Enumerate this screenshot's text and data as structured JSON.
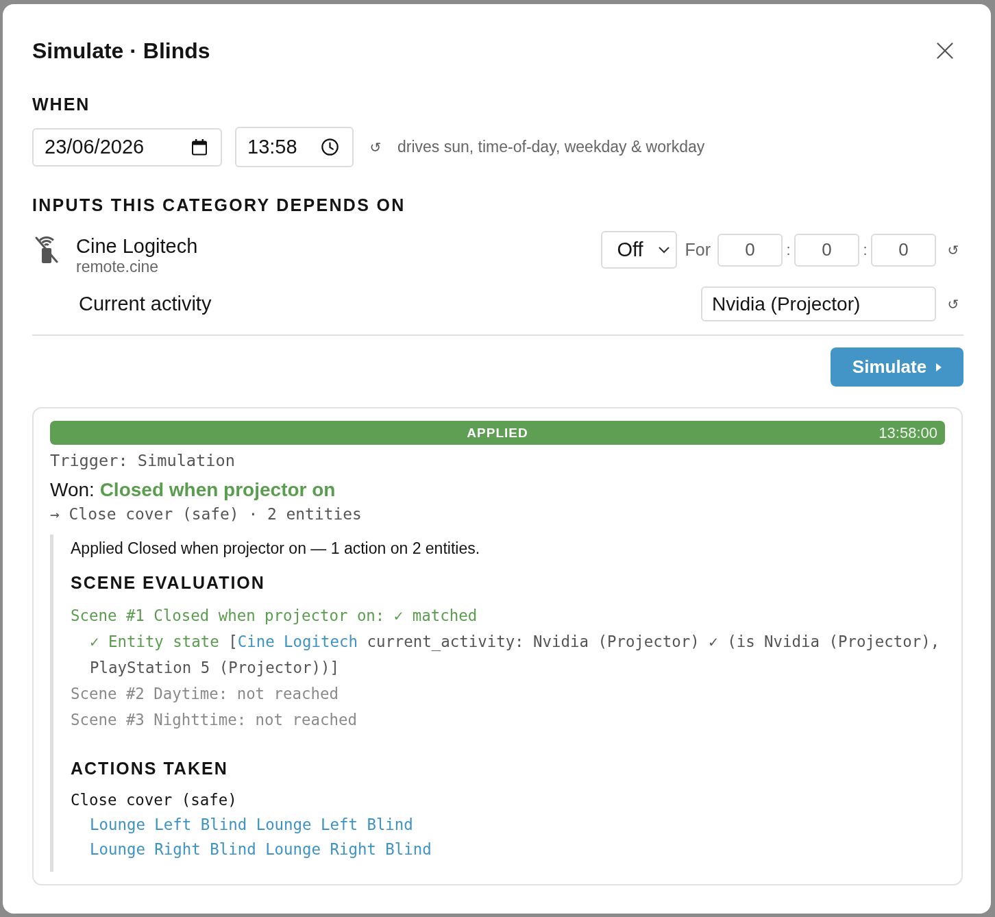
{
  "dialog": {
    "title": "Simulate · Blinds"
  },
  "when": {
    "heading": "WHEN",
    "date": {
      "value": "23/06/2026"
    },
    "time": {
      "value": "13:58"
    },
    "reset": "↺",
    "note": "drives sun, time-of-day, weekday & workday"
  },
  "inputs": {
    "heading": "INPUTS THIS CATEGORY DEPENDS ON",
    "device": {
      "name": "Cine Logitech",
      "entity_id": "remote.cine",
      "state": "Off",
      "for_label": "For",
      "duration": [
        "0",
        "0",
        "0"
      ],
      "separators": [
        ":",
        ":"
      ],
      "reset": "↺"
    },
    "attributes": [
      {
        "label": "Current activity",
        "value": "Nvidia (Projector)",
        "reset": "↺"
      }
    ]
  },
  "simulate_button": {
    "label": "Simulate"
  },
  "result": {
    "status": {
      "label": "APPLIED",
      "kind": "applied",
      "time": "13:58:00"
    },
    "trigger": "Trigger: Simulation",
    "won": {
      "label": "Won:",
      "scene": "Closed when projector on"
    },
    "summary": "→ Close cover (safe) · 2 entities",
    "detail": {
      "message": "Applied Closed when projector on — 1 action on 2 entities.",
      "scene_heading": "SCENE EVALUATION",
      "scenes": [
        {
          "text": "Scene #1 Closed when projector on: ✓ matched",
          "matched": true,
          "conditions": [
            {
              "passed": true,
              "result": "✓ Entity state",
              "open": "[",
              "entity": "Cine Logitech",
              "detail": "current_activity: Nvidia (Projector) ✓ (is Nvidia (Projector), PlayStation 5 (Projector))]"
            }
          ]
        },
        {
          "text": "Scene #2 Daytime: not reached",
          "matched": false
        },
        {
          "text": "Scene #3 Nighttime: not reached",
          "matched": false
        }
      ],
      "actions_heading": "ACTIONS TAKEN",
      "actions": [
        {
          "name": "Close cover (safe)",
          "entities": [
            "Lounge Left Blind Lounge Left Blind",
            "Lounge Right Blind Lounge Right Blind"
          ]
        }
      ]
    }
  }
}
